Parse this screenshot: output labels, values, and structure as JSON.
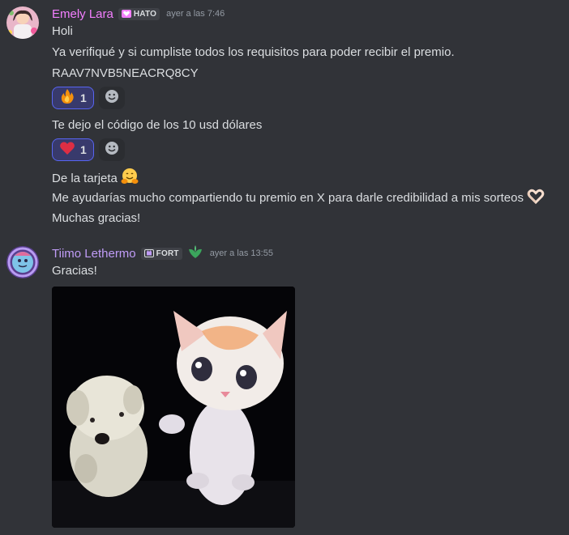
{
  "messages": [
    {
      "author": "Emely Lara",
      "author_color": "#f47fff",
      "tag": "HATO",
      "tag_icon": "heart-tag-icon",
      "timestamp": "ayer a las 7:46",
      "lines": [
        "Holi",
        "Ya verifiqué y si cumpliste todos los requisitos para poder recibir el premio.",
        "RAAV7NVB5NEACRQ8CY",
        "Te dejo el código de los 10 usd dólares",
        "De la tarjeta",
        "Me ayudarías mucho compartiendo tu premio en X para darle credibilidad a mis sorteos",
        "Muchas gracias!"
      ],
      "reactions": [
        {
          "emoji": "fire-emoji",
          "count": "1"
        },
        {
          "emoji": "heart-emoji",
          "count": "1"
        }
      ]
    },
    {
      "author": "Tiimo Lethermo",
      "author_color": "#c09cf7",
      "tag": "FORT",
      "tag_icon": "fort-tag-icon",
      "badge": "green-leaf-icon",
      "timestamp": "ayer a las 13:55",
      "lines": [
        "Gracias!"
      ],
      "attachment": "dancing-puppy-and-kitten-gif"
    }
  ],
  "colors": {
    "background": "#313338",
    "reaction_bg": "#383a6c",
    "reaction_border": "#5865f2"
  }
}
